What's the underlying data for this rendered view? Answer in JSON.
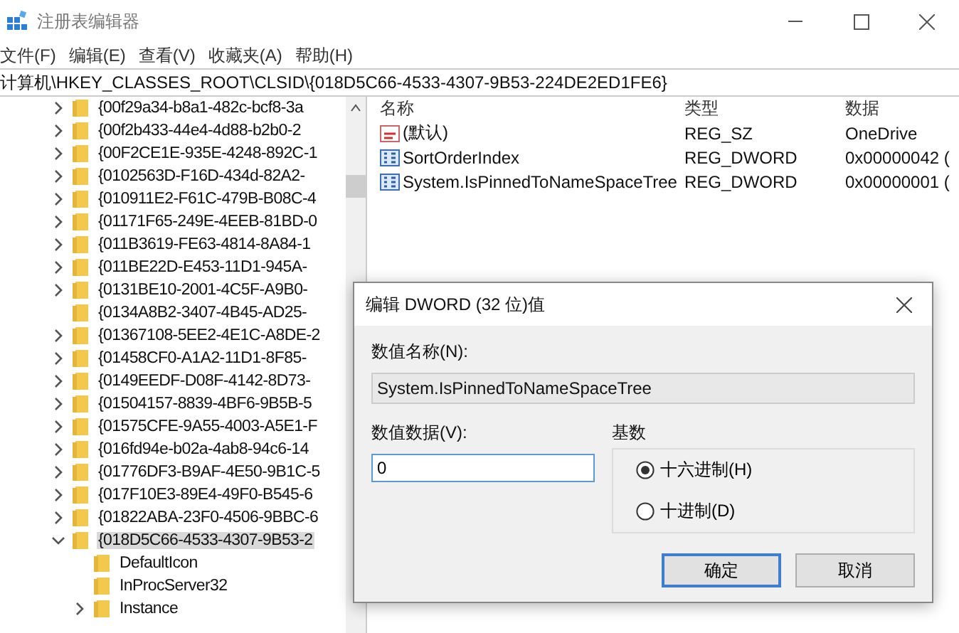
{
  "window": {
    "title": "注册表编辑器"
  },
  "menu": [
    "文件(F)",
    "编辑(E)",
    "查看(V)",
    "收藏夹(A)",
    "帮助(H)"
  ],
  "address": "计算机\\HKEY_CLASSES_ROOT\\CLSID\\{018D5C66-4533-4307-9B53-224DE2ED1FE6}",
  "tree": [
    {
      "label": "{00f29a34-b8a1-482c-bcf8-3a",
      "expandable": true,
      "expanded": false,
      "selected": false
    },
    {
      "label": "{00f2b433-44e4-4d88-b2b0-2",
      "expandable": true,
      "expanded": false,
      "selected": false
    },
    {
      "label": "{00F2CE1E-935E-4248-892C-1",
      "expandable": true,
      "expanded": false,
      "selected": false
    },
    {
      "label": "{0102563D-F16D-434d-82A2-",
      "expandable": true,
      "expanded": false,
      "selected": false
    },
    {
      "label": "{010911E2-F61C-479B-B08C-4",
      "expandable": true,
      "expanded": false,
      "selected": false
    },
    {
      "label": "{01171F65-249E-4EEB-81BD-0",
      "expandable": true,
      "expanded": false,
      "selected": false
    },
    {
      "label": "{011B3619-FE63-4814-8A84-1",
      "expandable": true,
      "expanded": false,
      "selected": false
    },
    {
      "label": "{011BE22D-E453-11D1-945A-",
      "expandable": true,
      "expanded": false,
      "selected": false
    },
    {
      "label": "{0131BE10-2001-4C5F-A9B0-",
      "expandable": true,
      "expanded": false,
      "selected": false
    },
    {
      "label": "{0134A8B2-3407-4B45-AD25-",
      "expandable": false,
      "expanded": false,
      "selected": false
    },
    {
      "label": "{01367108-5EE2-4E1C-A8DE-2",
      "expandable": true,
      "expanded": false,
      "selected": false
    },
    {
      "label": "{01458CF0-A1A2-11D1-8F85-",
      "expandable": true,
      "expanded": false,
      "selected": false
    },
    {
      "label": "{0149EEDF-D08F-4142-8D73-",
      "expandable": true,
      "expanded": false,
      "selected": false
    },
    {
      "label": "{01504157-8839-4BF6-9B5B-5",
      "expandable": true,
      "expanded": false,
      "selected": false
    },
    {
      "label": "{01575CFE-9A55-4003-A5E1-F",
      "expandable": true,
      "expanded": false,
      "selected": false
    },
    {
      "label": "{016fd94e-b02a-4ab8-94c6-14",
      "expandable": true,
      "expanded": false,
      "selected": false
    },
    {
      "label": "{01776DF3-B9AF-4E50-9B1C-5",
      "expandable": true,
      "expanded": false,
      "selected": false
    },
    {
      "label": "{017F10E3-89E4-49F0-B545-6",
      "expandable": true,
      "expanded": false,
      "selected": false
    },
    {
      "label": "{01822ABA-23F0-4506-9BBC-6",
      "expandable": true,
      "expanded": false,
      "selected": false
    },
    {
      "label": "{018D5C66-4533-4307-9B53-2",
      "expandable": true,
      "expanded": true,
      "selected": true,
      "children": [
        {
          "label": "DefaultIcon",
          "expandable": false,
          "expanded": false,
          "selected": false
        },
        {
          "label": "InProcServer32",
          "expandable": false,
          "expanded": false,
          "selected": false
        },
        {
          "label": "Instance",
          "expandable": true,
          "expanded": false,
          "selected": false
        }
      ]
    }
  ],
  "values": {
    "columns": [
      "名称",
      "类型",
      "数据"
    ],
    "rows": [
      {
        "kind": "string",
        "name": "(默认)",
        "type": "REG_SZ",
        "data": "OneDrive"
      },
      {
        "kind": "binary",
        "name": "SortOrderIndex",
        "type": "REG_DWORD",
        "data": "0x00000042 ("
      },
      {
        "kind": "binary",
        "name": "System.IsPinnedToNameSpaceTree",
        "type": "REG_DWORD",
        "data": "0x00000001 ("
      }
    ]
  },
  "dialog": {
    "title": "编辑 DWORD (32 位)值",
    "name_label": "数值名称(N):",
    "name_value": "System.IsPinnedToNameSpaceTree",
    "data_label": "数值数据(V):",
    "data_value": "0",
    "base_label": "基数",
    "bases": [
      {
        "label": "十六进制(H)",
        "selected": true
      },
      {
        "label": "十进制(D)",
        "selected": false
      }
    ],
    "buttons": [
      {
        "label": "确定",
        "default": true
      },
      {
        "label": "取消",
        "default": false
      }
    ]
  }
}
